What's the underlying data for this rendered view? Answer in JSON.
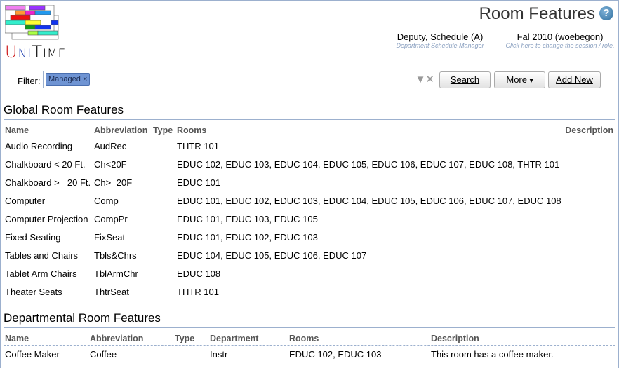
{
  "header": {
    "logo_text": "UniTime",
    "title": "Room Features",
    "help_icon": "question-circle-icon"
  },
  "user": {
    "name": "Deputy, Schedule (A)",
    "role": "Department Schedule Manager"
  },
  "session": {
    "name": "Fal 2010 (woebegon)",
    "hint": "Click here to change the session / role."
  },
  "filter": {
    "label": "Filter:",
    "chip": "Managed",
    "chip_remove": "×",
    "dropdown_icon": "▼",
    "clear_icon": "✕"
  },
  "buttons": {
    "search": "Search",
    "more": "More",
    "more_arrow": "▾",
    "add_new": "Add New"
  },
  "global": {
    "title": "Global Room Features",
    "columns": [
      "Name",
      "Abbreviation",
      "Type",
      "Rooms",
      "Description"
    ],
    "rows": [
      {
        "name": "Audio Recording",
        "abbr": "AudRec",
        "type": "",
        "rooms": "THTR 101",
        "desc": ""
      },
      {
        "name": "Chalkboard < 20 Ft.",
        "abbr": "Ch<20F",
        "type": "",
        "rooms": "EDUC 102, EDUC 103, EDUC 104, EDUC 105, EDUC 106, EDUC 107, EDUC 108, THTR 101",
        "desc": ""
      },
      {
        "name": "Chalkboard >= 20 Ft.",
        "abbr": "Ch>=20F",
        "type": "",
        "rooms": "EDUC 101",
        "desc": ""
      },
      {
        "name": "Computer",
        "abbr": "Comp",
        "type": "",
        "rooms": "EDUC 101, EDUC 102, EDUC 103, EDUC 104, EDUC 105, EDUC 106, EDUC 107, EDUC 108",
        "desc": ""
      },
      {
        "name": "Computer Projection",
        "abbr": "CompPr",
        "type": "",
        "rooms": "EDUC 101, EDUC 103, EDUC 105",
        "desc": ""
      },
      {
        "name": "Fixed Seating",
        "abbr": "FixSeat",
        "type": "",
        "rooms": "EDUC 101, EDUC 102, EDUC 103",
        "desc": ""
      },
      {
        "name": "Tables and Chairs",
        "abbr": "Tbls&Chrs",
        "type": "",
        "rooms": "EDUC 104, EDUC 105, EDUC 106, EDUC 107",
        "desc": ""
      },
      {
        "name": "Tablet Arm Chairs",
        "abbr": "TblArmChr",
        "type": "",
        "rooms": "EDUC 108",
        "desc": ""
      },
      {
        "name": "Theater Seats",
        "abbr": "ThtrSeat",
        "type": "",
        "rooms": "THTR 101",
        "desc": ""
      }
    ]
  },
  "departmental": {
    "title": "Departmental Room Features",
    "columns": [
      "Name",
      "Abbreviation",
      "Type",
      "Department",
      "Rooms",
      "Description"
    ],
    "rows": [
      {
        "name": "Coffee Maker",
        "abbr": "Coffee",
        "type": "",
        "dept": "Instr",
        "rooms": "EDUC 102, EDUC 103",
        "desc": "This room has a coffee maker."
      }
    ]
  }
}
